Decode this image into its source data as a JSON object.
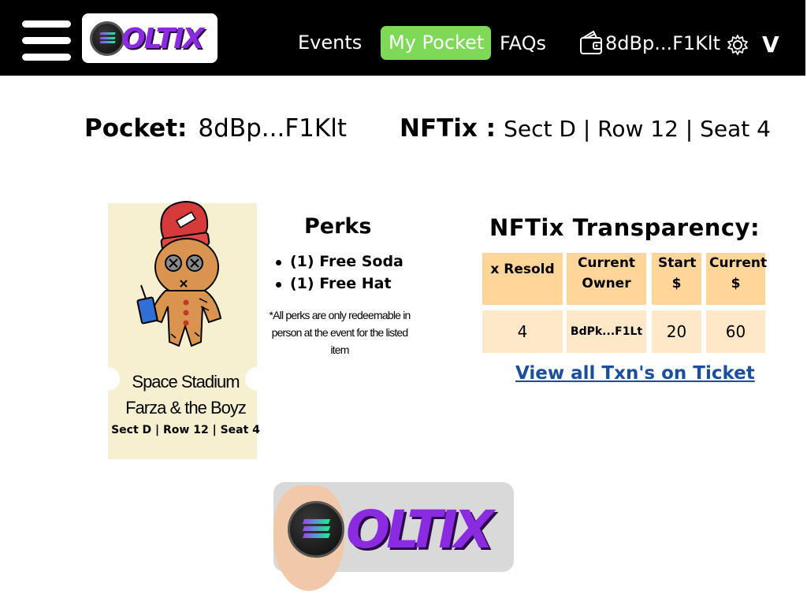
{
  "header": {
    "logo_text": "OLTIX",
    "nav": {
      "events": "Events",
      "my_pocket": "My Pocket",
      "faqs": "FAQs"
    },
    "wallet_address": "8dBp...F1Klt",
    "account_chevron": "V",
    "active_color": "#7ed957"
  },
  "info": {
    "pocket_label": "Pocket:",
    "pocket_value": "8dBp...F1Klt",
    "nftix_label": "NFTix :",
    "nftix_value": "Sect D | Row 12 | Seat 4"
  },
  "ticket": {
    "venue": "Space Stadium",
    "artist": "Farza & the Boyz",
    "seat": "Sect D | Row 12 | Seat 4"
  },
  "perks": {
    "title": "Perks",
    "items": [
      "(1) Free Soda",
      "(1) Free Hat"
    ],
    "note": "*All perks are only redeemable in person at the event for the listed item"
  },
  "transparency": {
    "title": "NFTix Transparency:",
    "headers": [
      "x Resold",
      "Current Owner",
      "Start $",
      "Current $"
    ],
    "values": [
      "4",
      "BdPk...F1Lt",
      "20",
      "60"
    ],
    "link": "View all Txn's on Ticket"
  },
  "footer_logo_text": "OLTIX"
}
